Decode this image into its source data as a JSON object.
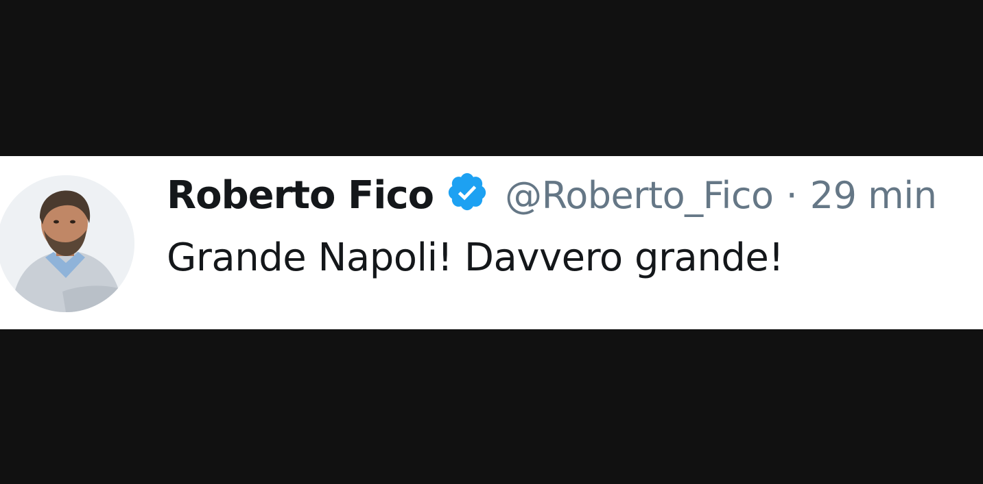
{
  "tweet": {
    "author_name": "Roberto Fico",
    "handle": "@Roberto_Fico",
    "separator": "·",
    "time": "29 min",
    "text": "Grande Napoli! Davvero grande!",
    "verified_icon": "verified-badge-icon",
    "colors": {
      "verified": "#1da1f2",
      "name": "#14171a",
      "meta": "#657786",
      "background": "#ffffff",
      "frame": "#111111"
    }
  }
}
